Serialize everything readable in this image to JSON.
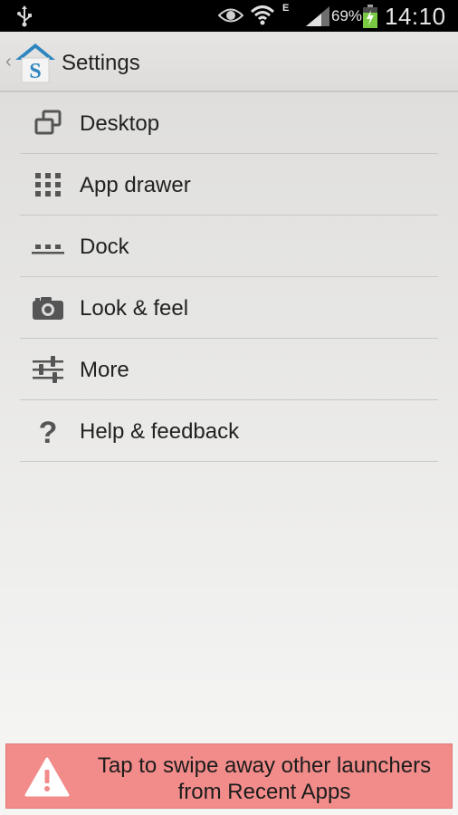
{
  "status_bar": {
    "network_type": "E",
    "battery_percent": "69%",
    "time": "14:10",
    "icons": [
      "usb-icon",
      "eye-icon",
      "wifi-icon",
      "signal-icon",
      "battery-charging-icon"
    ]
  },
  "action_bar": {
    "title": "Settings",
    "logo_letter": "S",
    "back_icon": "chevron-left-icon"
  },
  "menu": {
    "items": [
      {
        "label": "Desktop",
        "icon": "desktop-windows-icon"
      },
      {
        "label": "App drawer",
        "icon": "app-drawer-grid-icon"
      },
      {
        "label": "Dock",
        "icon": "dock-icon"
      },
      {
        "label": "Look & feel",
        "icon": "camera-icon"
      },
      {
        "label": "More",
        "icon": "sliders-icon"
      },
      {
        "label": "Help & feedback",
        "icon": "question-mark-icon"
      }
    ]
  },
  "banner": {
    "line1": "Tap to swipe away other launchers",
    "line2": "from Recent Apps",
    "icon": "warning-icon"
  },
  "colors": {
    "banner_background": "#f18c8a",
    "logo_blue": "#2e86c1",
    "battery_green": "#7ac943",
    "icon_gray": "#555555"
  }
}
